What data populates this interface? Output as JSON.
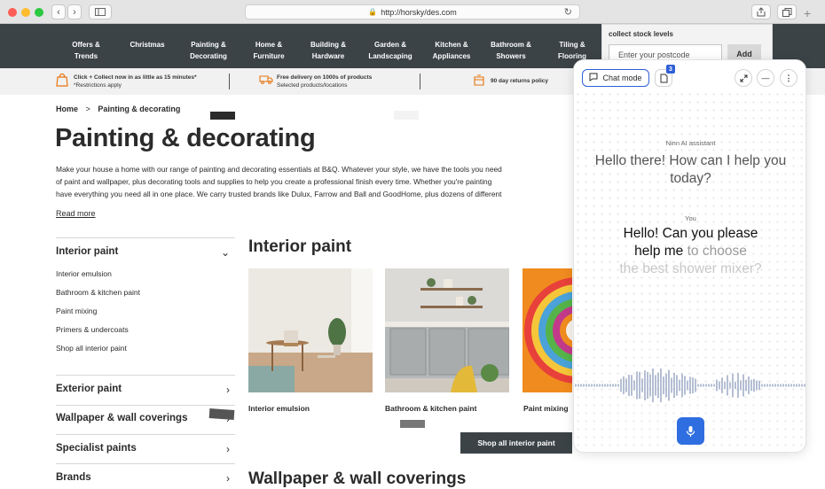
{
  "browser": {
    "url": "http://horsky/des.com",
    "back_icon": "chevron-left-icon",
    "forward_icon": "chevron-right-icon",
    "new_tab": "+"
  },
  "nav": {
    "items": [
      {
        "line1": "Offers &",
        "line2": "Trends"
      },
      {
        "line1": "Christmas",
        "line2": ""
      },
      {
        "line1": "Painting &",
        "line2": "Decorating"
      },
      {
        "line1": "Home &",
        "line2": "Furniture"
      },
      {
        "line1": "Building &",
        "line2": "Hardware"
      },
      {
        "line1": "Garden &",
        "line2": "Landscaping"
      },
      {
        "line1": "Kitchen &",
        "line2": "Appliances"
      },
      {
        "line1": "Bathroom &",
        "line2": "Showers"
      },
      {
        "line1": "Tiling &",
        "line2": "Flooring"
      }
    ]
  },
  "usp": {
    "click_collect": {
      "title": "Click + Collect now in as little as 15 minutes*",
      "sub": "*Restrictions apply"
    },
    "delivery": {
      "title": "Free delivery on 1000s of products",
      "sub": "Selected products/locations"
    },
    "returns": {
      "title": "90 day returns policy"
    }
  },
  "stock": {
    "title": "collect stock levels",
    "placeholder": "Enter your postcode",
    "button": "Add"
  },
  "breadcrumb": {
    "home": "Home",
    "sep": ">",
    "current": "Painting & decorating"
  },
  "page_title": "Painting & decorating",
  "intro": {
    "line1": "Make your house a home with our range of painting and decorating essentials at B&Q. Whatever your style, we have the tools you need",
    "line2": "of paint and wallpaper, plus decorating tools and supplies to help you create a professional finish every time. Whether you're painting",
    "line3": "have everything you need all in one place. We carry trusted brands like Dulux, Farrow and Ball and GoodHome, plus dozens of different",
    "read_more": "Read more"
  },
  "sidebar": {
    "interior_heading": "Interior paint",
    "interior_links": [
      "Interior emulsion",
      "Bathroom & kitchen paint",
      "Paint mixing",
      "Primers & undercoats",
      "Shop all interior paint"
    ],
    "sections": [
      "Exterior paint",
      "Wallpaper & wall coverings",
      "Specialist paints",
      "Brands"
    ]
  },
  "main": {
    "section_title": "Interior paint",
    "cards": [
      "Interior emulsion",
      "Bathroom & kitchen paint",
      "Paint mixing"
    ],
    "shop_all": "Shop all interior paint",
    "next_section": "Wallpaper & wall coverings"
  },
  "chat": {
    "mode_label": "Chat mode",
    "doc_badge": "3",
    "assistant_label": "Ninn AI assistant",
    "assistant_msg": "Hello there! How can I help you today?",
    "you_label": "You",
    "user_msg_a": "Hello! Can you please",
    "user_msg_b": "help me",
    "user_msg_c": "to choose",
    "user_msg_d": "the best shower mixer?"
  },
  "colors": {
    "nav_bg": "#3b4347",
    "accent": "#2f6ee0",
    "orange": "#e8730c"
  }
}
